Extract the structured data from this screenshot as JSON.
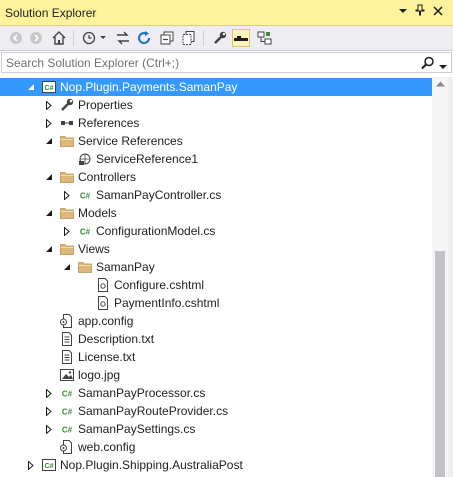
{
  "window": {
    "title": "Solution Explorer"
  },
  "search": {
    "placeholder": "Search Solution Explorer (Ctrl+;)"
  },
  "toolbar": {
    "buttons": [
      "back-icon",
      "forward-icon",
      "home-icon",
      "pending-changes-icon",
      "sync-icon",
      "refresh-icon",
      "collapse-all-icon",
      "show-all-files-icon",
      "properties-icon",
      "preview-icon",
      "view-class-diagram-icon"
    ]
  },
  "colors": {
    "title_bar": "#fff29d",
    "selection": "#3399ff",
    "csharp_green": "#388a34",
    "folder": "#dcb67a"
  },
  "tree": {
    "items": [
      {
        "label": "Nop.Plugin.Payments.SamanPay",
        "icon": "csharp-project-icon",
        "level": 0,
        "expander": "expanded",
        "selected": true
      },
      {
        "label": "Properties",
        "icon": "wrench-icon",
        "level": 1,
        "expander": "collapsed"
      },
      {
        "label": "References",
        "icon": "references-icon",
        "level": 1,
        "expander": "collapsed"
      },
      {
        "label": "Service References",
        "icon": "folder-icon",
        "level": 1,
        "expander": "expanded"
      },
      {
        "label": "ServiceReference1",
        "icon": "service-reference-icon",
        "level": 2,
        "expander": "none"
      },
      {
        "label": "Controllers",
        "icon": "folder-icon",
        "level": 1,
        "expander": "expanded"
      },
      {
        "label": "SamanPayController.cs",
        "icon": "csharp-file-icon",
        "level": 2,
        "expander": "collapsed"
      },
      {
        "label": "Models",
        "icon": "folder-icon",
        "level": 1,
        "expander": "expanded"
      },
      {
        "label": "ConfigurationModel.cs",
        "icon": "csharp-file-icon",
        "level": 2,
        "expander": "collapsed"
      },
      {
        "label": "Views",
        "icon": "folder-icon",
        "level": 1,
        "expander": "expanded"
      },
      {
        "label": "SamanPay",
        "icon": "folder-icon",
        "level": 2,
        "expander": "expanded"
      },
      {
        "label": "Configure.cshtml",
        "icon": "razor-file-icon",
        "level": 3,
        "expander": "none"
      },
      {
        "label": "PaymentInfo.cshtml",
        "icon": "razor-file-icon",
        "level": 3,
        "expander": "none"
      },
      {
        "label": "app.config",
        "icon": "config-file-icon",
        "level": 1,
        "expander": "none"
      },
      {
        "label": "Description.txt",
        "icon": "text-file-icon",
        "level": 1,
        "expander": "none"
      },
      {
        "label": "License.txt",
        "icon": "text-file-icon",
        "level": 1,
        "expander": "none"
      },
      {
        "label": "logo.jpg",
        "icon": "image-file-icon",
        "level": 1,
        "expander": "none"
      },
      {
        "label": "SamanPayProcessor.cs",
        "icon": "csharp-file-icon",
        "level": 1,
        "expander": "collapsed"
      },
      {
        "label": "SamanPayRouteProvider.cs",
        "icon": "csharp-file-icon",
        "level": 1,
        "expander": "collapsed"
      },
      {
        "label": "SamanPaySettings.cs",
        "icon": "csharp-file-icon",
        "level": 1,
        "expander": "collapsed"
      },
      {
        "label": "web.config",
        "icon": "config-file-icon",
        "level": 1,
        "expander": "none"
      },
      {
        "label": "Nop.Plugin.Shipping.AustraliaPost",
        "icon": "csharp-project-icon",
        "level": 0,
        "expander": "collapsed"
      }
    ]
  }
}
